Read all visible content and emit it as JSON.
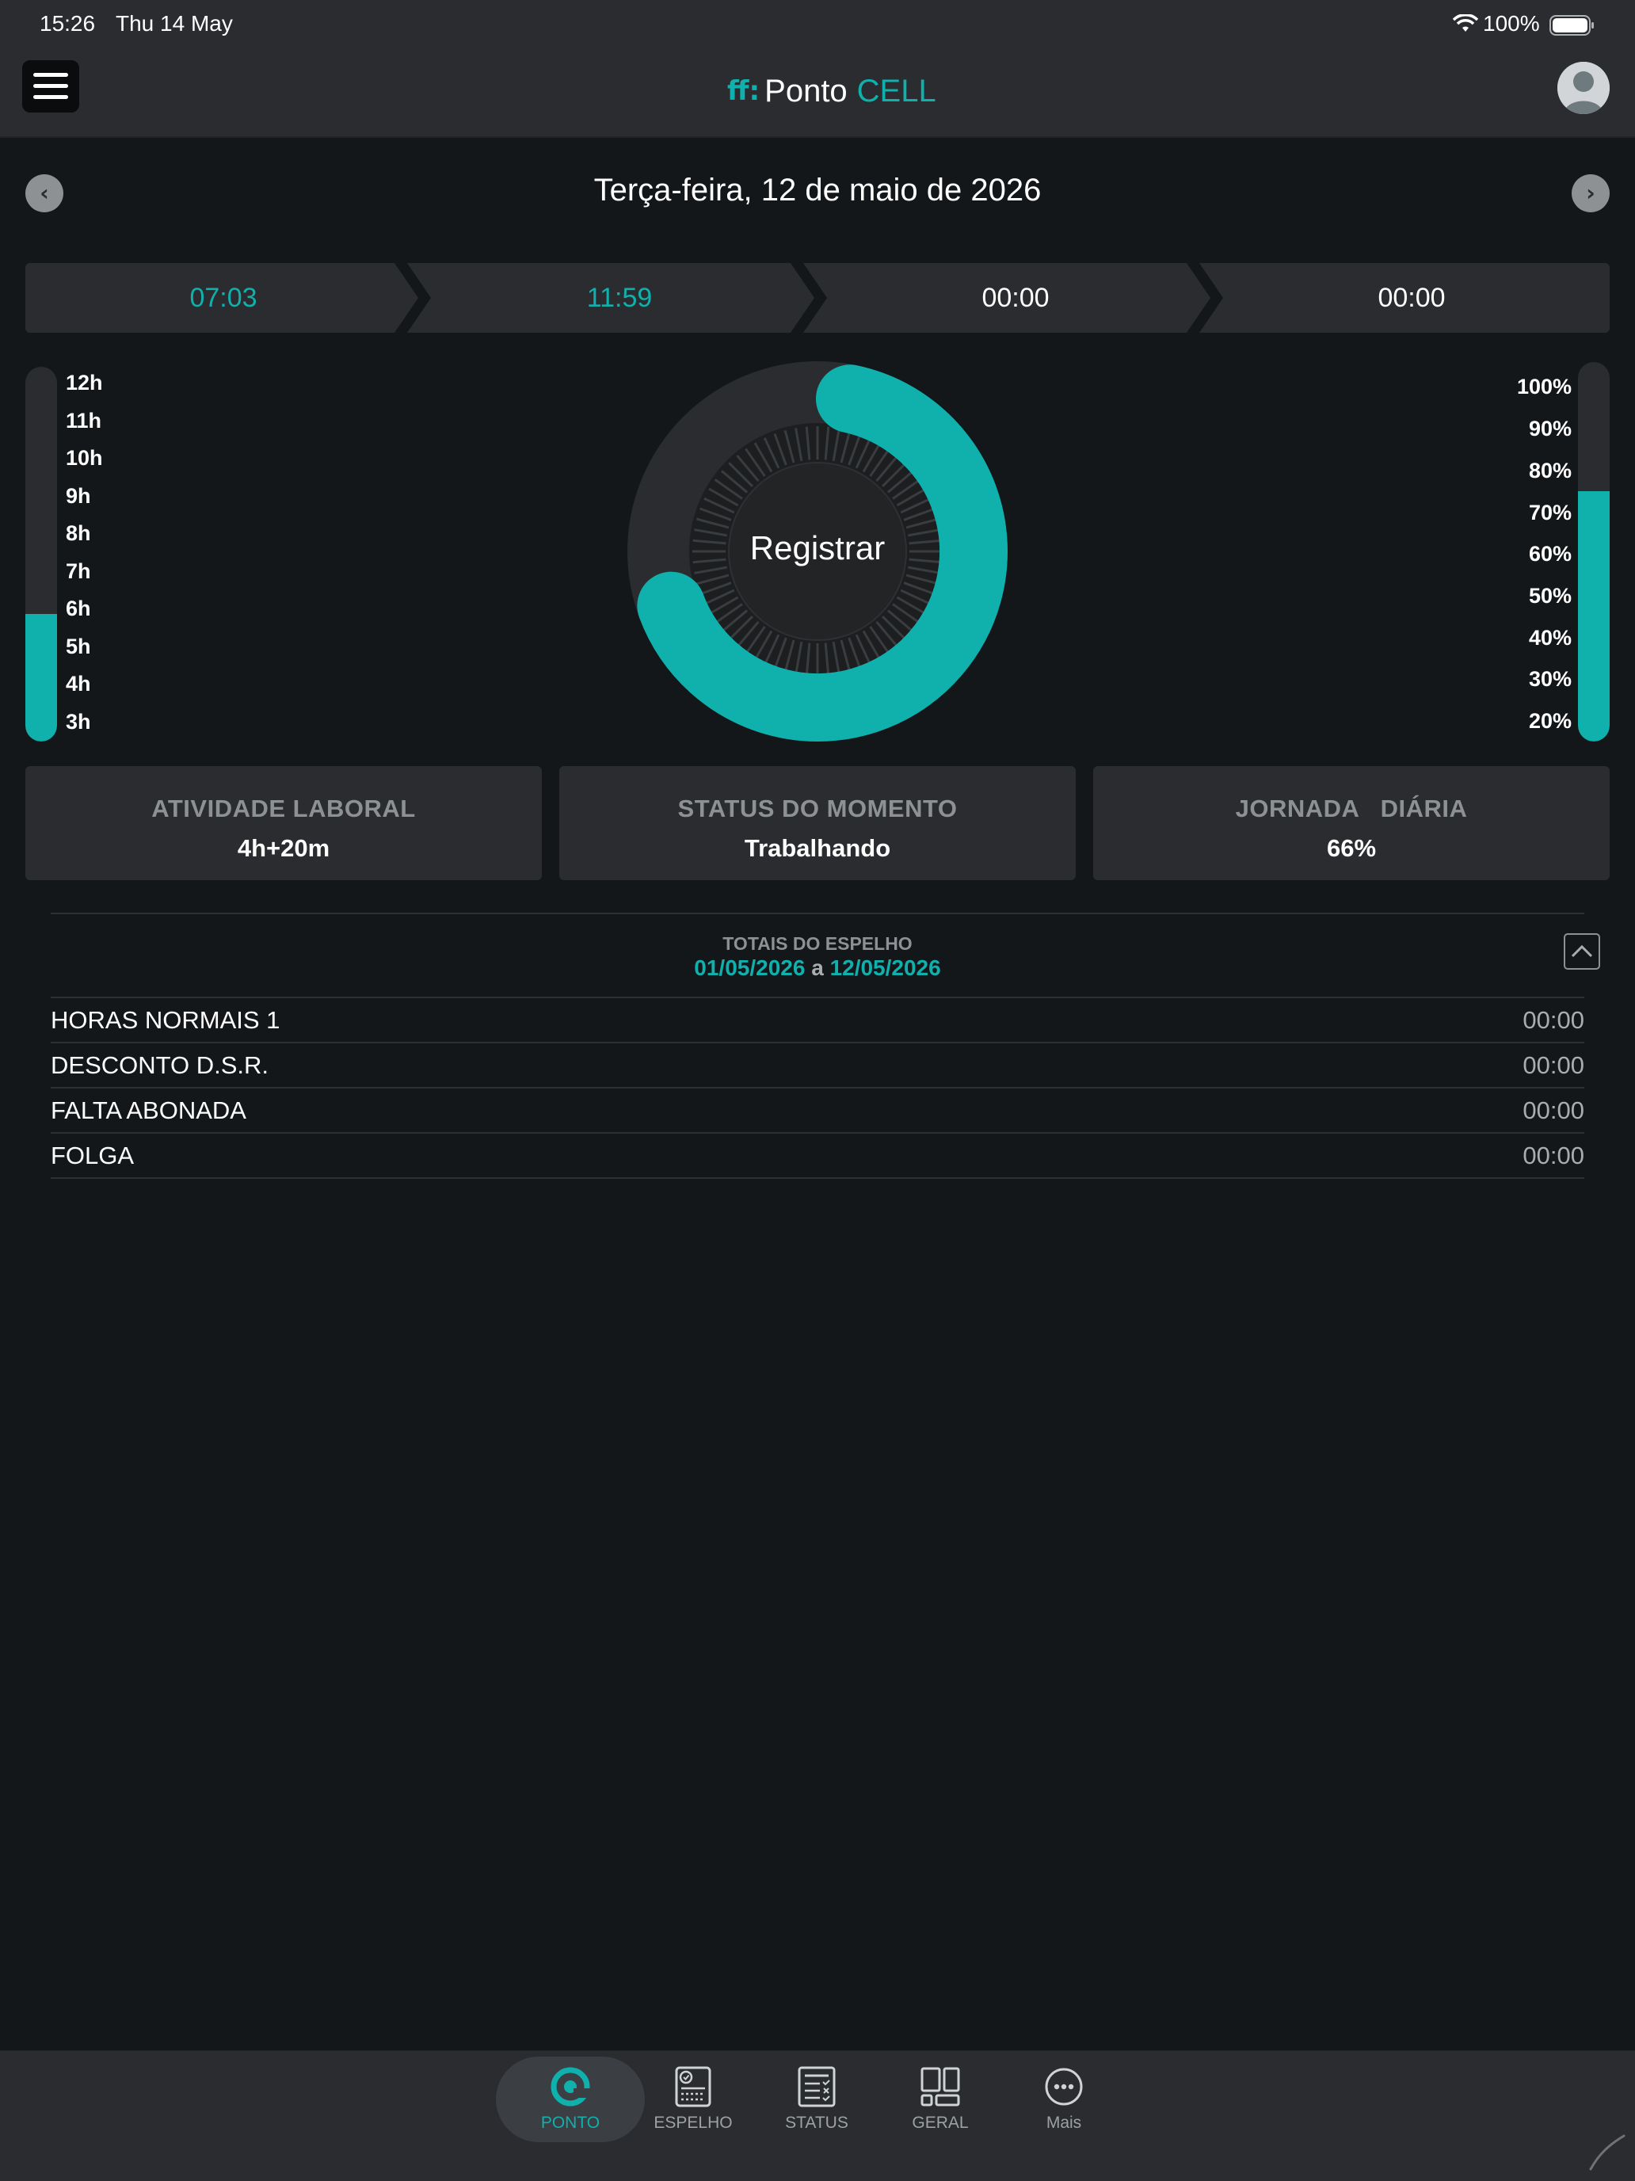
{
  "status_bar": {
    "time": "15:26",
    "date": "Thu 14 May",
    "battery": "100%"
  },
  "header": {
    "logo_mark": "ff:",
    "logo_word1": "Ponto",
    "logo_word2": "CELL"
  },
  "date_nav": {
    "title": "Terça-feira, 12 de maio de 2026",
    "prev": "‹",
    "next": "›"
  },
  "punches": [
    {
      "time": "07:03",
      "registered": true
    },
    {
      "time": "11:59",
      "registered": true
    },
    {
      "time": "00:00",
      "registered": false
    },
    {
      "time": "00:00",
      "registered": false
    }
  ],
  "hours_gauge": {
    "labels": [
      "12h",
      "11h",
      "10h",
      "9h",
      "8h",
      "7h",
      "6h",
      "5h",
      "4h",
      "3h"
    ],
    "fill_fraction": 0.34
  },
  "percent_gauge": {
    "labels": [
      "100%",
      "90%",
      "80%",
      "70%",
      "60%",
      "50%",
      "40%",
      "30%",
      "20%"
    ],
    "fill_fraction": 0.66
  },
  "ring": {
    "label": "Registrar",
    "progress_fraction": 0.66
  },
  "cards": [
    {
      "title": "ATIVIDADE LABORAL",
      "value": "4h+20m"
    },
    {
      "title": "STATUS DO MOMENTO",
      "value": "Trabalhando"
    },
    {
      "title": "JORNADA   DIÁRIA",
      "value": "66%"
    }
  ],
  "totals": {
    "title": "TOTAIS DO ESPELHO",
    "start": "01/05/2026",
    "sep": "a",
    "end": "12/05/2026",
    "rows": [
      {
        "label": "HORAS NORMAIS 1",
        "value": "00:00"
      },
      {
        "label": "DESCONTO D.S.R.",
        "value": "00:00"
      },
      {
        "label": "FALTA ABONADA",
        "value": "00:00"
      },
      {
        "label": "FOLGA",
        "value": "00:00"
      }
    ]
  },
  "tabs": [
    {
      "label": "PONTO",
      "icon": "ponto-icon",
      "active": true
    },
    {
      "label": "ESPELHO",
      "icon": "espelho-icon",
      "active": false
    },
    {
      "label": "STATUS",
      "icon": "status-icon",
      "active": false
    },
    {
      "label": "GERAL",
      "icon": "geral-icon",
      "active": false
    },
    {
      "label": "Mais",
      "icon": "more-icon",
      "active": false
    }
  ],
  "colors": {
    "accent": "#10b0ad",
    "background": "#13171a",
    "surface": "#2a2c2f",
    "muted": "#8d9194"
  }
}
